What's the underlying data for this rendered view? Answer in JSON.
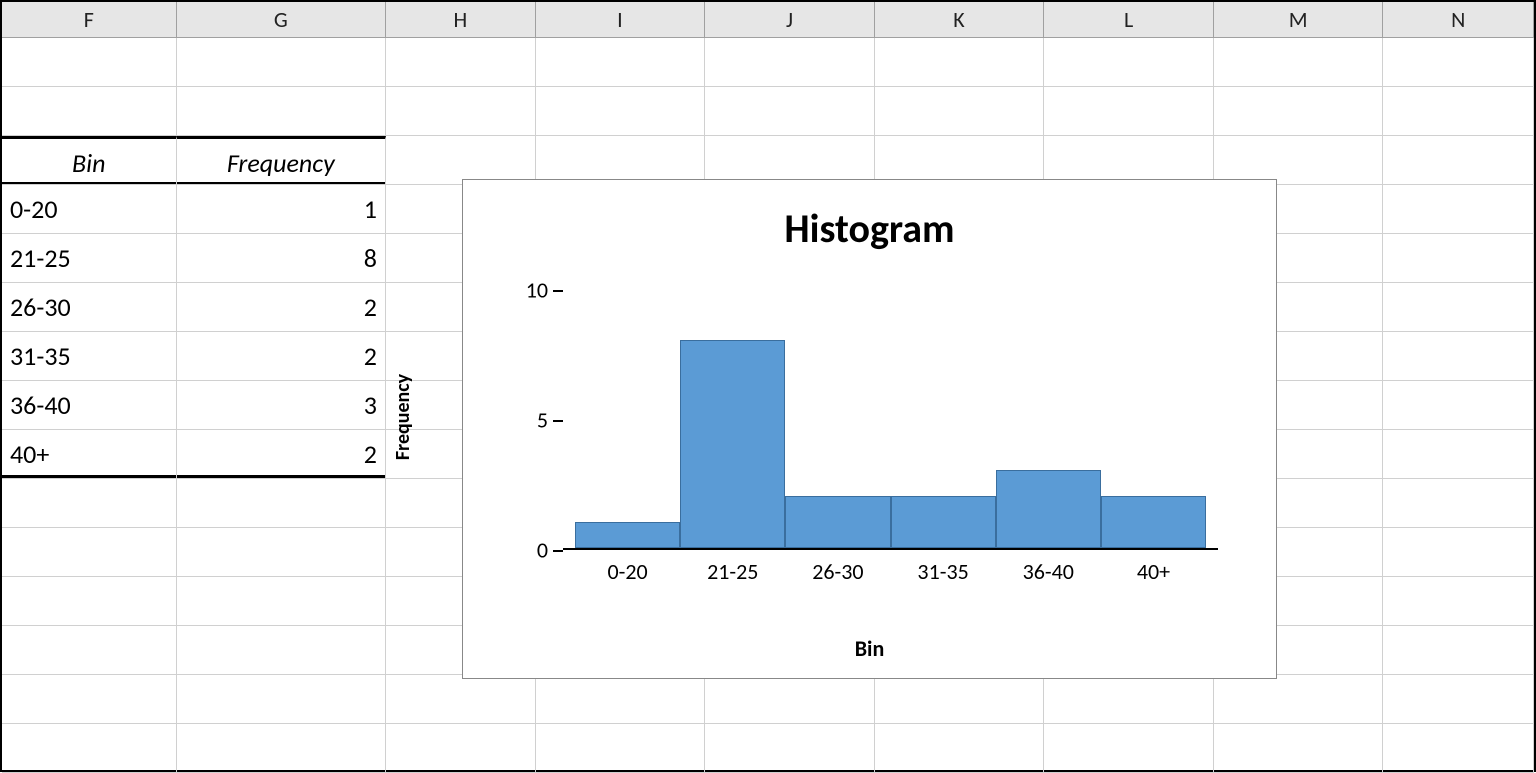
{
  "columns": [
    "F",
    "G",
    "H",
    "I",
    "J",
    "K",
    "L",
    "M",
    "N"
  ],
  "table": {
    "header_bin": "Bin",
    "header_freq": "Frequency",
    "rows": [
      {
        "bin": "0-20",
        "freq": "1"
      },
      {
        "bin": "21-25",
        "freq": "8"
      },
      {
        "bin": "26-30",
        "freq": "2"
      },
      {
        "bin": "31-35",
        "freq": "2"
      },
      {
        "bin": "36-40",
        "freq": "3"
      },
      {
        "bin": "40+",
        "freq": "2"
      }
    ]
  },
  "chart_data": {
    "type": "bar",
    "title": "Histogram",
    "xlabel": "Bin",
    "ylabel": "Frequency",
    "categories": [
      "0-20",
      "21-25",
      "26-30",
      "31-35",
      "36-40",
      "40+"
    ],
    "values": [
      1,
      8,
      2,
      2,
      3,
      2
    ],
    "ylim": [
      0,
      10
    ],
    "yticks": [
      0,
      5,
      10
    ]
  }
}
